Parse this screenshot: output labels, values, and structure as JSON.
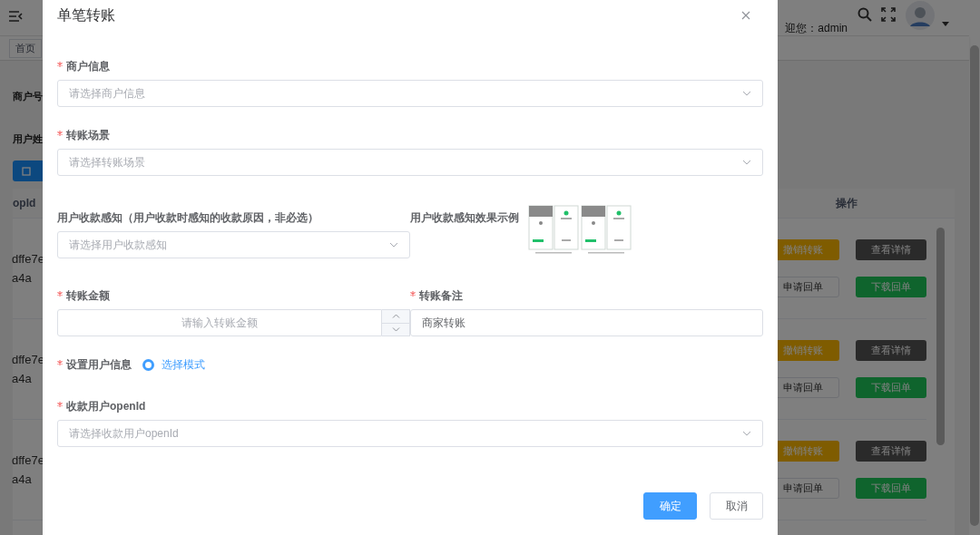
{
  "background": {
    "header": {
      "welcome": "迎您：admin"
    },
    "tabs": [
      {
        "label": "首页"
      }
    ],
    "filters": [
      "商户号",
      "用户姓"
    ],
    "table": {
      "columns": [
        "opId",
        "操作"
      ],
      "rows": [
        {
          "column_1": [
            "dffe7e",
            "a4a"
          ],
          "actions": [
            {
              "label": "撤销转账",
              "kind": "warning"
            },
            {
              "label": "查看详情",
              "kind": "info"
            },
            {
              "label": "申请回单",
              "kind": "plain"
            },
            {
              "label": "下载回单",
              "kind": "success"
            }
          ]
        },
        {
          "column_1": [
            "dffe7e",
            "a4a"
          ],
          "actions": [
            {
              "label": "撤销转账",
              "kind": "warning"
            },
            {
              "label": "查看详情",
              "kind": "info"
            },
            {
              "label": "申请回单",
              "kind": "plain"
            },
            {
              "label": "下载回单",
              "kind": "success"
            }
          ]
        },
        {
          "column_1": [
            "dffe7e",
            "a4a"
          ],
          "actions": [
            {
              "label": "撤销转账",
              "kind": "warning"
            },
            {
              "label": "查看详情",
              "kind": "info"
            },
            {
              "label": "申请回单",
              "kind": "plain"
            },
            {
              "label": "下载回单",
              "kind": "success"
            }
          ]
        }
      ]
    }
  },
  "dialog": {
    "title": "单笔转账",
    "rows": [
      {
        "fields": [
          {
            "label": "商户信息",
            "required": true,
            "kind": "select",
            "placeholder": "请选择商户信息"
          }
        ]
      },
      {
        "fields": [
          {
            "label": "转账场景",
            "required": true,
            "kind": "select",
            "placeholder": "请选择转账场景"
          }
        ]
      },
      {
        "fields": [
          {
            "label": "用户收款感知（用户收款时感知的收款原因，非必选）",
            "required": false,
            "kind": "select",
            "placeholder": "请选择用户收款感知"
          },
          {
            "label": "用户收款感知效果示例",
            "required": false,
            "kind": "image"
          }
        ]
      },
      {
        "fields": [
          {
            "label": "转账金额",
            "required": true,
            "kind": "number",
            "placeholder": "请输入转账金额"
          },
          {
            "label": "转账备注",
            "required": true,
            "kind": "text",
            "value": "商家转账"
          }
        ]
      },
      {
        "fields": [
          {
            "label": "设置用户信息",
            "required": true,
            "kind": "radio",
            "options": [
              {
                "label": "选择模式",
                "selected": true
              }
            ]
          }
        ]
      },
      {
        "fields": [
          {
            "label": "收款用户openId",
            "required": true,
            "kind": "select",
            "placeholder": "请选择收款用户openId"
          }
        ]
      }
    ],
    "buttons": [
      {
        "label": "确定",
        "kind": "primary"
      },
      {
        "label": "取消",
        "kind": "default"
      }
    ]
  }
}
